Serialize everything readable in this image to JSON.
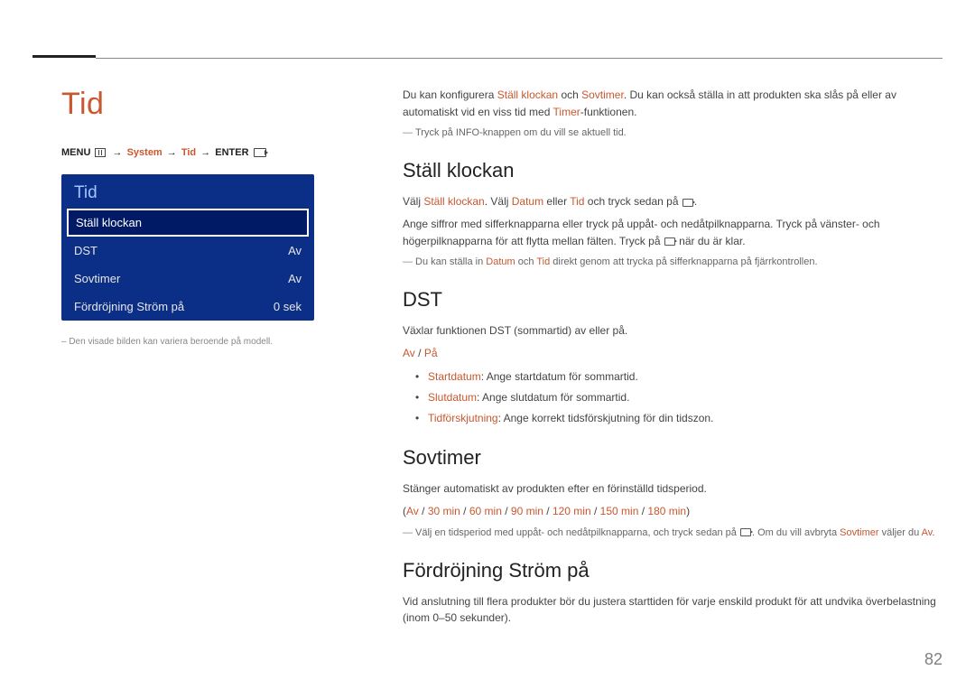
{
  "page_number": "82",
  "left": {
    "title": "Tid",
    "breadcrumb": {
      "menu": "MENU",
      "system": "System",
      "tid": "Tid",
      "enter": "ENTER"
    },
    "panel": {
      "title": "Tid",
      "items": [
        {
          "label": "Ställ klockan",
          "value": "",
          "selected": true
        },
        {
          "label": "DST",
          "value": "Av",
          "selected": false
        },
        {
          "label": "Sovtimer",
          "value": "Av",
          "selected": false
        },
        {
          "label": "Fördröjning Ström på",
          "value": "0 sek",
          "selected": false
        }
      ]
    },
    "footnote": "– Den visade bilden kan variera beroende på modell."
  },
  "right": {
    "intro1a": "Du kan konfigurera ",
    "intro1b": "Ställ klockan",
    "intro1c": " och ",
    "intro1d": "Sovtimer",
    "intro1e": ". Du kan också ställa in att produkten ska slås på eller av automatiskt vid en viss tid med ",
    "intro1f": "Timer",
    "intro1g": "-funktionen.",
    "intro_note": "Tryck på INFO-knappen om du vill se aktuell tid.",
    "sec1": {
      "h": "Ställ klockan",
      "p1a": "Välj ",
      "p1b": "Ställ klockan",
      "p1c": ". Välj ",
      "p1d": "Datum",
      "p1e": " eller ",
      "p1f": "Tid",
      "p1g": " och tryck sedan på ",
      "p1h": ".",
      "p2a": "Ange siffror med sifferknapparna eller tryck på uppåt- och nedåtpilknapparna. Tryck på vänster- och högerpilknapparna för att flytta mellan fälten. Tryck på ",
      "p2b": " när du är klar.",
      "note_a": "Du kan ställa in ",
      "note_b": "Datum",
      "note_c": " och ",
      "note_d": "Tid",
      "note_e": " direkt genom att trycka på sifferknapparna på fjärrkontrollen."
    },
    "sec2": {
      "h": "DST",
      "p1": "Växlar funktionen DST (sommartid) av eller på.",
      "opt_a": "Av",
      "opt_sep": " / ",
      "opt_b": "På",
      "b1_k": "Startdatum",
      "b1_v": ": Ange startdatum för sommartid.",
      "b2_k": "Slutdatum",
      "b2_v": ": Ange slutdatum för sommartid.",
      "b3_k": "Tidförskjutning",
      "b3_v": ": Ange korrekt tidsförskjutning för din tidszon."
    },
    "sec3": {
      "h": "Sovtimer",
      "p1": "Stänger automatiskt av produkten efter en förinställd tidsperiod.",
      "opts": [
        "Av",
        "30 min",
        "60 min",
        "90 min",
        "120 min",
        "150 min",
        "180 min"
      ],
      "note_a": "Välj en tidsperiod med uppåt- och nedåtpilknapparna, och tryck sedan på ",
      "note_b": ". Om du vill avbryta ",
      "note_c": "Sovtimer",
      "note_d": " väljer du ",
      "note_e": "Av",
      "note_f": "."
    },
    "sec4": {
      "h": "Fördröjning Ström på",
      "p1": "Vid anslutning till flera produkter bör du justera starttiden för varje enskild produkt för att undvika överbelastning (inom 0–50 sekunder)."
    }
  }
}
